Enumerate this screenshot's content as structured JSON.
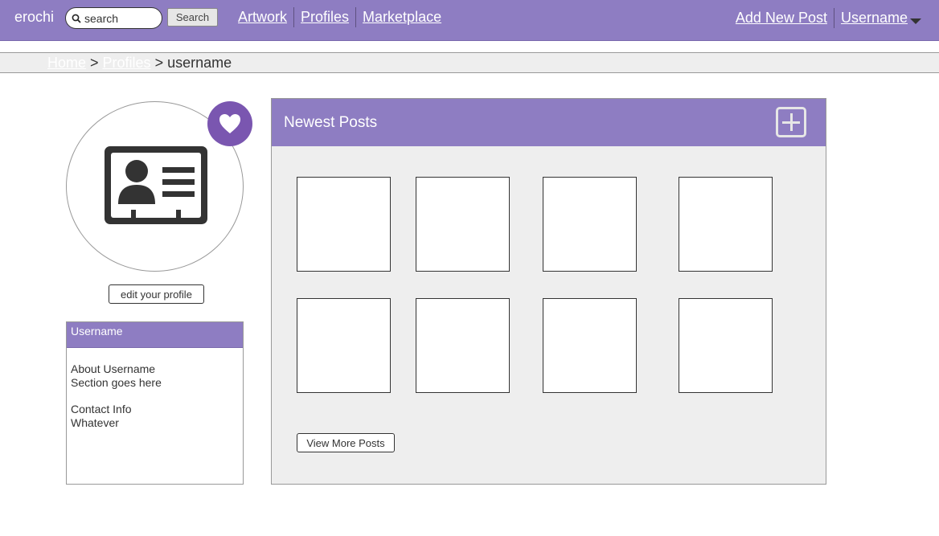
{
  "header": {
    "brand": "erochi",
    "search": {
      "placeholder": "search",
      "button_label": "Search"
    },
    "nav": [
      "Artwork",
      "Profiles",
      "Marketplace"
    ],
    "add_post_label": "Add New Post",
    "user_label": "Username"
  },
  "breadcrumb": [
    "Home",
    "Profiles",
    "username"
  ],
  "profile": {
    "edit_label": "edit your profile",
    "panel_title": "Username",
    "about_lines": [
      "About Username",
      "Section goes here"
    ],
    "contact_lines": [
      "Contact Info",
      "Whatever"
    ]
  },
  "posts": {
    "title": "Newest Posts",
    "view_more_label": "View More Posts"
  },
  "colors": {
    "accent": "#8e7dc2",
    "heart_badge": "#7a56b0",
    "panel_bg": "#eeeeee"
  }
}
